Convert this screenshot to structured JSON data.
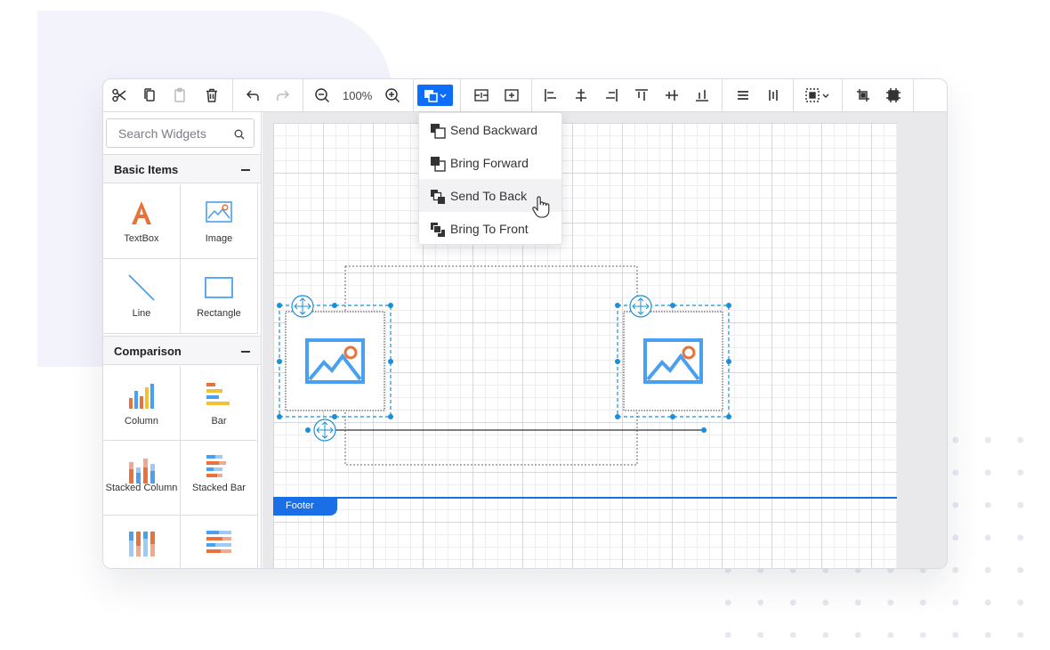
{
  "toolbar": {
    "zoom_level": "100%",
    "buttons": [
      {
        "name": "cut-icon"
      },
      {
        "name": "copy-icon"
      },
      {
        "name": "paste-icon"
      },
      {
        "name": "delete-icon"
      },
      {
        "name": "undo-icon"
      },
      {
        "name": "redo-icon"
      },
      {
        "name": "zoom-out-icon"
      },
      {
        "name": "zoom-in-icon"
      },
      {
        "name": "order-icon"
      },
      {
        "name": "align-icons"
      }
    ],
    "accent_color": "#0d6efd"
  },
  "sidebar": {
    "search_placeholder": "Search Widgets",
    "sections": [
      {
        "title": "Basic Items",
        "items": [
          {
            "label": "TextBox",
            "icon": "textbox-icon"
          },
          {
            "label": "Image",
            "icon": "image-icon"
          },
          {
            "label": "Line",
            "icon": "line-icon"
          },
          {
            "label": "Rectangle",
            "icon": "rectangle-icon"
          }
        ]
      },
      {
        "title": "Comparison",
        "items": [
          {
            "label": "Column",
            "icon": "column-chart-icon"
          },
          {
            "label": "Bar",
            "icon": "bar-chart-icon"
          },
          {
            "label": "Stacked Column",
            "icon": "stacked-column-icon"
          },
          {
            "label": "Stacked Bar",
            "icon": "stacked-bar-icon"
          }
        ]
      }
    ]
  },
  "canvas": {
    "footer_label": "Footer"
  },
  "order_menu": {
    "items": [
      {
        "label": "Send Backward"
      },
      {
        "label": "Bring Forward"
      },
      {
        "label": "Send To Back"
      },
      {
        "label": "Bring To Front"
      }
    ],
    "hovered_index": 2
  }
}
